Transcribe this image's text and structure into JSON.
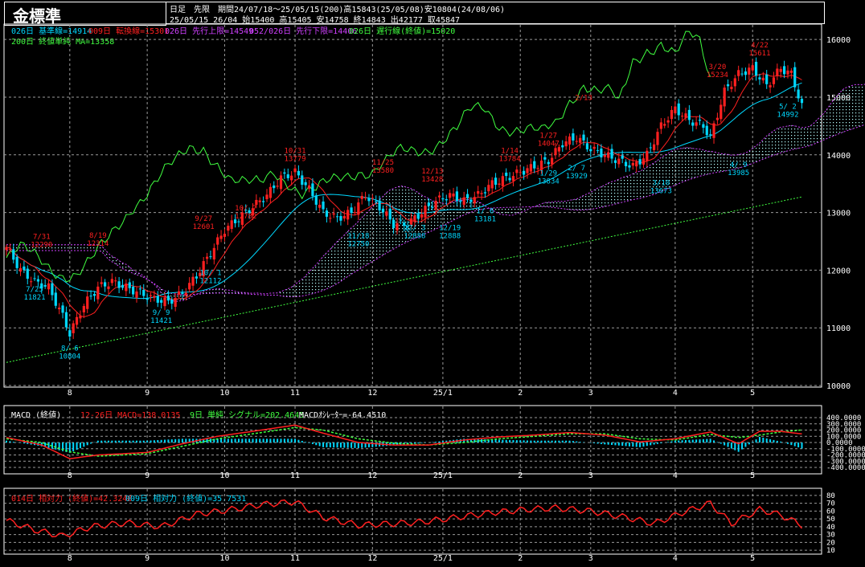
{
  "header": {
    "title": "金標準",
    "line1": "日足　先限　期間24/07/18～25/05/15(200)高15843(25/05/08)安10804(24/08/06)",
    "line2": "25/05/15 26/04 始15400 高15405 安14758 終14843 出42177 取45847"
  },
  "legend_main": [
    {
      "text": "026日 基準線=14914",
      "color": "#00d8ff"
    },
    {
      "text": "009日 転換線=15301",
      "color": "#ff2020"
    },
    {
      "text": "026日 先行上限=14549",
      "color": "#d040ff"
    },
    {
      "text": "052/026日 先行下限=14406",
      "color": "#d040ff"
    },
    {
      "text": "026日 遅行線(終値)=15020",
      "color": "#40ff40"
    },
    {
      "text": "200日 終値単純 MA=13358",
      "color": "#40ff40"
    }
  ],
  "legend_macd": [
    {
      "text": "MACD (終値)",
      "color": "#ffffff"
    },
    {
      "text": "12-26日 MACD=138.0135",
      "color": "#ff2020"
    },
    {
      "text": "9日 単純 シグナル=202.4645",
      "color": "#40ff40"
    },
    {
      "text": "MACDｵｼﾚｰﾀｰ=-64.4510",
      "color": "#ffffff"
    }
  ],
  "legend_rsi": [
    {
      "text": "014日 相対力 (終値)=42.3248",
      "color": "#ff2020"
    },
    {
      "text": "009日 相対力 (終値)=35.7531",
      "color": "#00d8ff"
    }
  ],
  "chart_data": [
    {
      "type": "line",
      "subtype": "candlestick",
      "x_ticks": [
        "8",
        "9",
        "10",
        "11",
        "12",
        "25/1",
        "2",
        "3",
        "4",
        "5"
      ],
      "y_ticks": [
        10000,
        11000,
        12000,
        13000,
        14000,
        15000,
        16000
      ],
      "ylim": [
        10000,
        16100
      ],
      "grid": true,
      "close_points": [
        [
          0,
          12400
        ],
        [
          4,
          12000
        ],
        [
          8,
          11800
        ],
        [
          12,
          11700
        ],
        [
          16,
          11200
        ],
        [
          18,
          10900
        ],
        [
          22,
          11400
        ],
        [
          26,
          11700
        ],
        [
          30,
          11800
        ],
        [
          34,
          11700
        ],
        [
          38,
          11600
        ],
        [
          42,
          11500
        ],
        [
          46,
          11450
        ],
        [
          50,
          11600
        ],
        [
          54,
          11900
        ],
        [
          58,
          12300
        ],
        [
          62,
          12700
        ],
        [
          66,
          12900
        ],
        [
          70,
          13100
        ],
        [
          74,
          13300
        ],
        [
          78,
          13600
        ],
        [
          82,
          13700
        ],
        [
          86,
          13400
        ],
        [
          90,
          13000
        ],
        [
          94,
          12900
        ],
        [
          98,
          13000
        ],
        [
          102,
          13300
        ],
        [
          106,
          13100
        ],
        [
          110,
          12800
        ],
        [
          114,
          12800
        ],
        [
          118,
          13000
        ],
        [
          122,
          13200
        ],
        [
          126,
          13300
        ],
        [
          130,
          13200
        ],
        [
          134,
          13300
        ],
        [
          138,
          13500
        ],
        [
          142,
          13600
        ],
        [
          146,
          13700
        ],
        [
          150,
          13800
        ],
        [
          154,
          13900
        ],
        [
          158,
          14200
        ],
        [
          162,
          14300
        ],
        [
          166,
          14100
        ],
        [
          170,
          14000
        ],
        [
          174,
          13900
        ],
        [
          178,
          13800
        ],
        [
          182,
          14000
        ],
        [
          186,
          14500
        ],
        [
          190,
          14800
        ],
        [
          194,
          14600
        ],
        [
          198,
          14500
        ],
        [
          200,
          14300
        ],
        [
          204,
          15100
        ],
        [
          208,
          15400
        ],
        [
          212,
          15500
        ],
        [
          216,
          15200
        ],
        [
          220,
          15500
        ],
        [
          223,
          15400
        ],
        [
          226,
          14843
        ]
      ],
      "annotations": [
        {
          "x": 10,
          "y": 12290,
          "date": "7/31",
          "value": "12290",
          "kind": "high"
        },
        {
          "x": 8,
          "y": 11821,
          "date": "7/25",
          "value": "11821",
          "kind": "low"
        },
        {
          "x": 18,
          "y": 10804,
          "date": "8/ 6",
          "value": "10804",
          "kind": "low"
        },
        {
          "x": 26,
          "y": 12314,
          "date": "8/19",
          "value": "12314",
          "kind": "high"
        },
        {
          "x": 44,
          "y": 11421,
          "date": "9/ 9",
          "value": "11421",
          "kind": "low"
        },
        {
          "x": 56,
          "y": 12601,
          "date": "9/27",
          "value": "12601",
          "kind": "high"
        },
        {
          "x": 68,
          "y": 12782,
          "date": "10/ 7",
          "value": "12782",
          "kind": "high"
        },
        {
          "x": 58,
          "y": 12112,
          "date": "10/ 1",
          "value": "12112",
          "kind": "low"
        },
        {
          "x": 82,
          "y": 13779,
          "date": "10/31",
          "value": "13779",
          "kind": "high"
        },
        {
          "x": 100,
          "y": 12750,
          "date": "11/18",
          "value": "12750",
          "kind": "low"
        },
        {
          "x": 107,
          "y": 13580,
          "date": "11/25",
          "value": "13580",
          "kind": "high"
        },
        {
          "x": 116,
          "y": 12888,
          "date": "12/ 3",
          "value": "12888",
          "kind": "low"
        },
        {
          "x": 121,
          "y": 13428,
          "date": "12/13",
          "value": "13428",
          "kind": "high"
        },
        {
          "x": 126,
          "y": 12888,
          "date": "12/19",
          "value": "12888",
          "kind": "low"
        },
        {
          "x": 136,
          "y": 13181,
          "date": "1/ 6",
          "value": "13181",
          "kind": "low"
        },
        {
          "x": 143,
          "y": 13784,
          "date": "1/14",
          "value": "13784",
          "kind": "high"
        },
        {
          "x": 154,
          "y": 14047,
          "date": "1/27",
          "value": "14047",
          "kind": "high"
        },
        {
          "x": 154,
          "y": 13834,
          "date": "1/29",
          "value": "13834",
          "kind": "low"
        },
        {
          "x": 164,
          "y": 14700,
          "date": "2/13",
          "value": "",
          "kind": "high"
        },
        {
          "x": 162,
          "y": 13929,
          "date": "2/ 7",
          "value": "13929",
          "kind": "low"
        },
        {
          "x": 186,
          "y": 13673,
          "date": "3/10",
          "value": "13673",
          "kind": "low"
        },
        {
          "x": 202,
          "y": 15234,
          "date": "3/20",
          "value": "15234",
          "kind": "high"
        },
        {
          "x": 208,
          "y": 13985,
          "date": "4/ 9",
          "value": "13985",
          "kind": "low"
        },
        {
          "x": 214,
          "y": 15611,
          "date": "4/22",
          "value": "15611",
          "kind": "high"
        },
        {
          "x": 222,
          "y": 14992,
          "date": "5/ 2",
          "value": "14992",
          "kind": "low"
        }
      ]
    },
    {
      "type": "bar",
      "name": "MACD",
      "y_ticks": [
        400,
        300,
        200,
        100,
        0,
        -100,
        -200,
        -300,
        -400
      ],
      "y_tick_labels": [
        "400.0000",
        "300.0000",
        "200.0000",
        "100.0000",
        "0.0000",
        "-100.0000",
        "-200.0000",
        "-300.0000",
        "-400.0000"
      ],
      "ylim": [
        -400,
        400
      ],
      "macd_points": [
        [
          0,
          80
        ],
        [
          10,
          -40
        ],
        [
          18,
          -260
        ],
        [
          26,
          -200
        ],
        [
          40,
          -160
        ],
        [
          50,
          -20
        ],
        [
          60,
          100
        ],
        [
          70,
          180
        ],
        [
          82,
          280
        ],
        [
          90,
          150
        ],
        [
          100,
          0
        ],
        [
          110,
          -40
        ],
        [
          120,
          -40
        ],
        [
          130,
          40
        ],
        [
          140,
          90
        ],
        [
          150,
          120
        ],
        [
          160,
          160
        ],
        [
          170,
          120
        ],
        [
          180,
          10
        ],
        [
          190,
          60
        ],
        [
          200,
          170
        ],
        [
          208,
          -20
        ],
        [
          214,
          180
        ],
        [
          220,
          180
        ],
        [
          226,
          138
        ]
      ],
      "signal_points": [
        [
          0,
          60
        ],
        [
          10,
          0
        ],
        [
          18,
          -150
        ],
        [
          26,
          -220
        ],
        [
          40,
          -180
        ],
        [
          50,
          -60
        ],
        [
          60,
          60
        ],
        [
          70,
          140
        ],
        [
          82,
          240
        ],
        [
          90,
          200
        ],
        [
          100,
          60
        ],
        [
          110,
          -10
        ],
        [
          120,
          -40
        ],
        [
          130,
          0
        ],
        [
          140,
          60
        ],
        [
          150,
          100
        ],
        [
          160,
          140
        ],
        [
          170,
          140
        ],
        [
          180,
          60
        ],
        [
          190,
          40
        ],
        [
          200,
          130
        ],
        [
          208,
          80
        ],
        [
          214,
          120
        ],
        [
          220,
          170
        ],
        [
          226,
          202
        ]
      ]
    },
    {
      "type": "line",
      "name": "RSI",
      "y_ticks": [
        80,
        70,
        60,
        50,
        40,
        30,
        20,
        10
      ],
      "ylim": [
        5,
        85
      ],
      "rsi14_points": [
        [
          0,
          48
        ],
        [
          8,
          36
        ],
        [
          16,
          28
        ],
        [
          24,
          40
        ],
        [
          34,
          45
        ],
        [
          44,
          40
        ],
        [
          54,
          56
        ],
        [
          64,
          62
        ],
        [
          72,
          68
        ],
        [
          82,
          72
        ],
        [
          90,
          52
        ],
        [
          100,
          42
        ],
        [
          110,
          44
        ],
        [
          118,
          46
        ],
        [
          128,
          52
        ],
        [
          138,
          58
        ],
        [
          148,
          62
        ],
        [
          156,
          64
        ],
        [
          166,
          60
        ],
        [
          176,
          52
        ],
        [
          184,
          44
        ],
        [
          192,
          58
        ],
        [
          200,
          70
        ],
        [
          206,
          44
        ],
        [
          214,
          62
        ],
        [
          220,
          55
        ],
        [
          226,
          42
        ]
      ]
    }
  ]
}
